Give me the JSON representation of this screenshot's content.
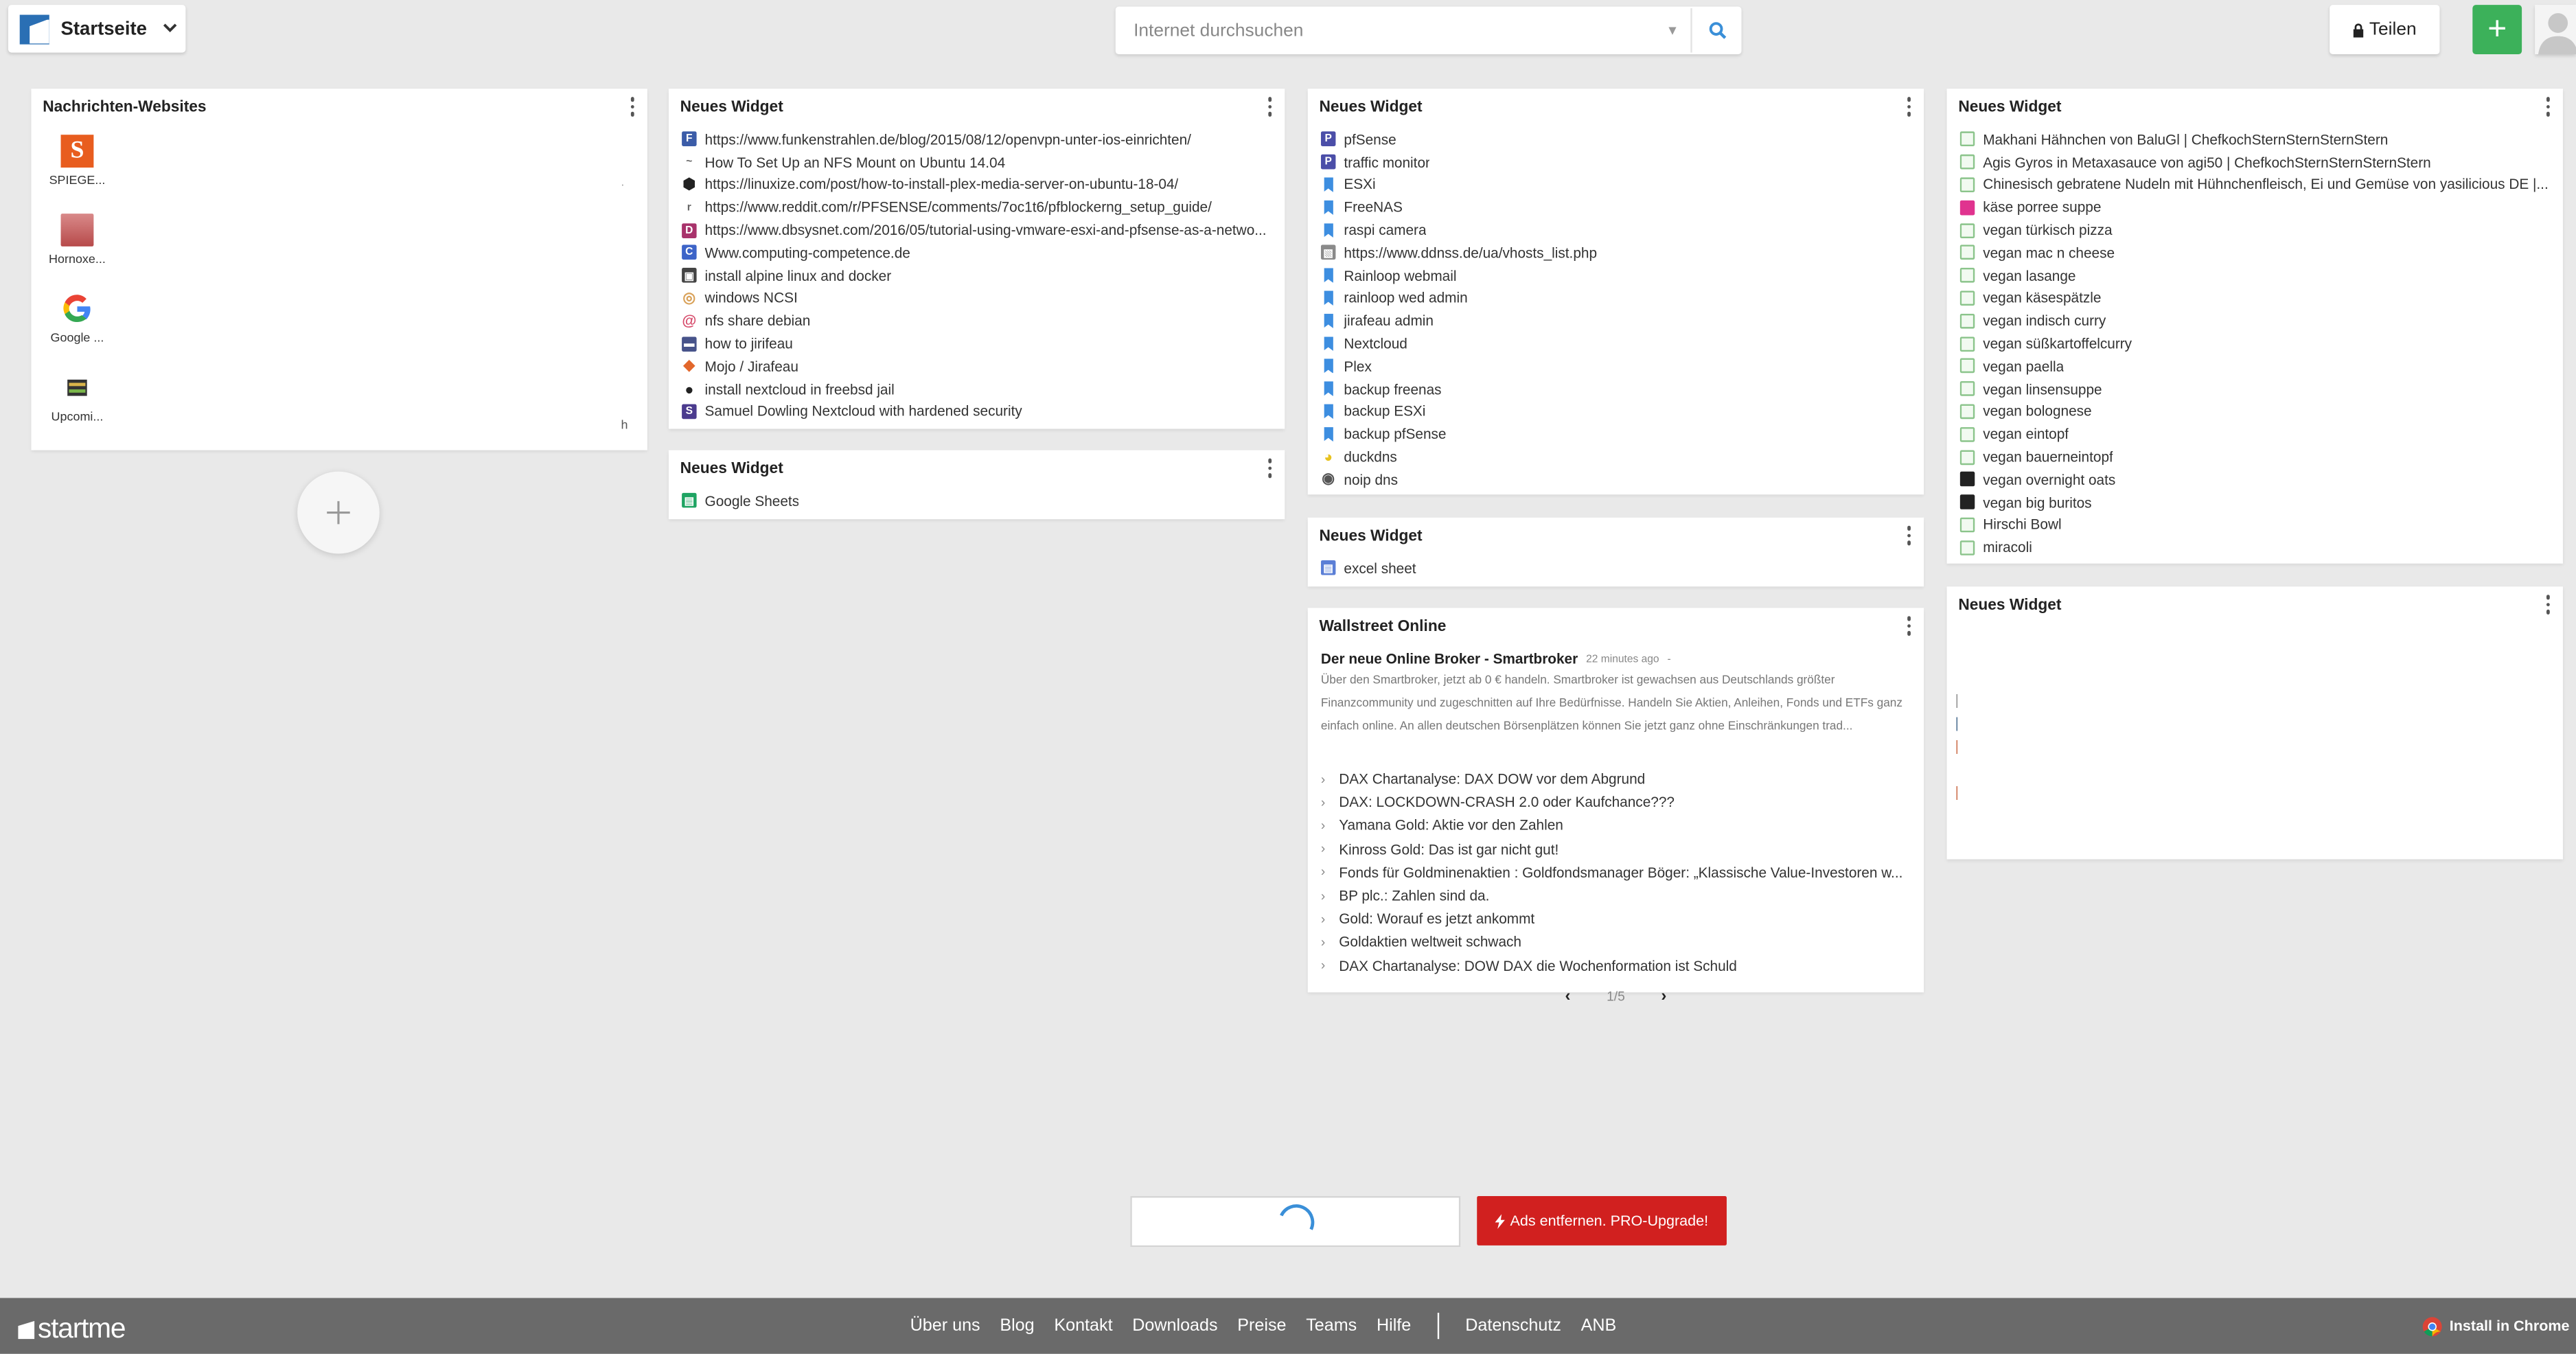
{
  "header": {
    "page_title": "Startseite",
    "search_placeholder": "Internet durchsuchen",
    "share_label": "Teilen",
    "add_label": "+"
  },
  "news_widget": {
    "title": "Nachrichten-Websites",
    "sites": [
      {
        "label": "SPIEGE...",
        "icon": "spiegel-logo-icon"
      },
      {
        "label": "Hornoxe...",
        "icon": "hornoxe-avatar-icon"
      },
      {
        "label": "Google ...",
        "icon": "google-logo-icon"
      },
      {
        "label": "Upcomi...",
        "icon": "upcoming-icon"
      }
    ],
    "side_marks": [
      ".",
      "h"
    ]
  },
  "widget1": {
    "title": "Neues Widget",
    "items": [
      {
        "text": "https://www.funkenstrahlen.de/blog/2015/08/12/openvpn-unter-ios-einrichten/",
        "icon": "F",
        "color": "#3b5ca8"
      },
      {
        "text": "How To Set Up an NFS Mount on Ubuntu 14.04",
        "icon": "~",
        "color": "#c0cde0"
      },
      {
        "text": "https://linuxize.com/post/how-to-install-plex-media-server-on-ubuntu-18-04/",
        "icon": "⬢",
        "color": "#222222"
      },
      {
        "text": "https://www.reddit.com/r/PFSENSE/comments/7oc1t6/pfblockerng_setup_guide/",
        "icon": "r",
        "color": "#bbbbbb"
      },
      {
        "text": "https://www.dbsysnet.com/2016/05/tutorial-using-vmware-esxi-and-pfsense-as-a-netwo...",
        "icon": "D",
        "color": "#a8326b"
      },
      {
        "text": "Www.computing-competence.de",
        "icon": "C",
        "color": "#3d64c8"
      },
      {
        "text": "install alpine linux and docker",
        "icon": "▣",
        "color": "#444444"
      },
      {
        "text": "windows NCSI",
        "icon": "◎",
        "color": "#d9a25a"
      },
      {
        "text": "nfs share debian",
        "icon": "@",
        "color": "#d64a6a"
      },
      {
        "text": "how to jirifeau",
        "icon": "▬",
        "color": "#47538a"
      },
      {
        "text": "Mojo / Jirafeau",
        "icon": "◆",
        "color": "#e2672b"
      },
      {
        "text": "install nextcloud in freebsd jail",
        "icon": "●",
        "color": "#222222"
      },
      {
        "text": "Samuel Dowling Nextcloud with hardened security",
        "icon": "S",
        "color": "#4b3b8e"
      }
    ]
  },
  "widget2": {
    "title": "Neues Widget",
    "items": [
      {
        "text": "Google Sheets",
        "icon": "▤",
        "color": "#1fa463"
      }
    ]
  },
  "widget3": {
    "title": "Neues Widget",
    "items": [
      {
        "text": "pfSense",
        "icon": "P",
        "color": "#4b4ea8"
      },
      {
        "text": "traffic monitor",
        "icon": "P",
        "color": "#4b4ea8"
      },
      {
        "text": "ESXi",
        "icon": "bm"
      },
      {
        "text": "FreeNAS",
        "icon": "bm"
      },
      {
        "text": "raspi camera",
        "icon": "bm"
      },
      {
        "text": "https://www.ddnss.de/ua/vhosts_list.php",
        "icon": "▧",
        "color": "#8a8a8a"
      },
      {
        "text": "Rainloop webmail",
        "icon": "bm"
      },
      {
        "text": "rainloop wed admin",
        "icon": "bm"
      },
      {
        "text": "jirafeau admin",
        "icon": "bm"
      },
      {
        "text": "Nextcloud",
        "icon": "bm"
      },
      {
        "text": "Plex",
        "icon": "bm"
      },
      {
        "text": "backup freenas",
        "icon": "bm"
      },
      {
        "text": "backup ESXi",
        "icon": "bm"
      },
      {
        "text": "backup pfSense",
        "icon": "bm"
      },
      {
        "text": "duckdns",
        "icon": "◕",
        "color": "#e8c21e"
      },
      {
        "text": "noip dns",
        "icon": "◉",
        "color": "#555555"
      }
    ]
  },
  "widget4": {
    "title": "Neues Widget",
    "items": [
      {
        "text": "excel sheet",
        "icon": "▤",
        "color": "#5b7fd6"
      }
    ]
  },
  "wallstreet": {
    "title": "Wallstreet Online",
    "top_title": "Der neue Online Broker - Smartbroker",
    "top_time": "22 minutes ago",
    "top_body": "Über den Smartbroker, jetzt ab 0 € handeln. Smartbroker ist gewachsen aus Deutschlands größter Finanzcommunity und zugeschnitten auf Ihre Bedürfnisse. Handeln Sie Aktien, Anleihen, Fonds und ETFs ganz einfach online. An allen deutschen Börsenplätzen können Sie jetzt ganz ohne Einschränkungen trad...",
    "items": [
      "DAX Chartanalyse: DAX DOW vor dem Abgrund",
      "DAX: LOCKDOWN-CRASH 2.0 oder Kaufchance???",
      "Yamana Gold: Aktie vor den Zahlen",
      "Kinross Gold: Das ist gar nicht gut!",
      "Fonds für Goldminenaktien : Goldfondsmanager Böger: „Klassische Value-Investoren w...",
      "BP plc.: Zahlen sind da.",
      "Gold: Worauf es jetzt ankommt",
      "Goldaktien weltweit schwach",
      "DAX Chartanalyse: DOW DAX die Wochenformation ist Schuld"
    ],
    "pager": "1/5",
    "prev": "‹",
    "next": "›"
  },
  "widget5": {
    "title": "Neues Widget",
    "items": [
      "Makhani Hähnchen von BaluGl | ChefkochSternSternSternStern",
      "Agis Gyros in Metaxasauce von agi50 | ChefkochSternSternSternStern",
      "Chinesisch gebratene Nudeln mit Hühnchenfleisch, Ei und Gemüse von yasilicious DE |...",
      "käse porree suppe",
      "vegan türkisch pizza",
      "vegan mac n cheese",
      "vegan lasange",
      "vegan käsespätzle",
      "vegan indisch curry",
      "vegan süßkartoffelcurry",
      "vegan paella",
      "vegan linsensuppe",
      "vegan bolognese",
      "vegan eintopf",
      "vegan bauerneintopf",
      "vegan overnight oats",
      "vegan big buritos",
      "Hirschi Bowl",
      "miracoli"
    ],
    "icon_kinds": [
      "rec",
      "rec",
      "rec",
      "pink",
      "rec",
      "rec",
      "rec",
      "rec",
      "rec",
      "rec",
      "rec",
      "rec",
      "rec",
      "rec",
      "rec",
      "dark",
      "dark",
      "rec",
      "rec"
    ]
  },
  "widget6": {
    "title": "Neues Widget",
    "marks": [
      "|",
      "|",
      "|",
      "|"
    ]
  },
  "ads": {
    "pro_label": "Ads entfernen. PRO-Upgrade!"
  },
  "footer": {
    "brand": "startme",
    "links": [
      "Über uns",
      "Blog",
      "Kontakt",
      "Downloads",
      "Preise",
      "Teams",
      "Hilfe"
    ],
    "links2": [
      "Datenschutz",
      "ANB"
    ],
    "chrome_label": "Install in Chrome"
  }
}
